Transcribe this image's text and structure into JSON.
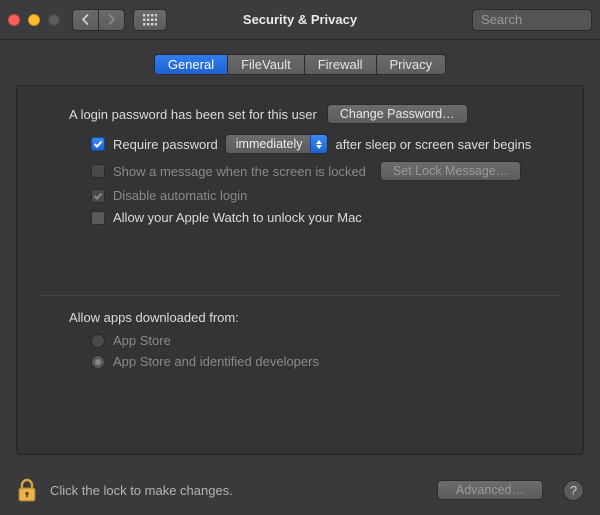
{
  "window": {
    "title": "Security & Privacy"
  },
  "search": {
    "placeholder": "Search",
    "value": ""
  },
  "tabs": {
    "general": "General",
    "filevault": "FileVault",
    "firewall": "Firewall",
    "privacy": "Privacy"
  },
  "general": {
    "login_text": "A login password has been set for this user",
    "change_password_btn": "Change Password…",
    "require_password_label": "Require password",
    "require_password_delay": "immediately",
    "require_password_tail": "after sleep or screen saver begins",
    "show_message_label": "Show a message when the screen is locked",
    "set_lock_message_btn": "Set Lock Message…",
    "disable_auto_login_label": "Disable automatic login",
    "apple_watch_label": "Allow your Apple Watch to unlock your Mac",
    "allow_apps_heading": "Allow apps downloaded from:",
    "gatekeeper_app_store": "App Store",
    "gatekeeper_identified": "App Store and identified developers"
  },
  "footer": {
    "lock_text": "Click the lock to make changes.",
    "advanced_btn": "Advanced…",
    "help_label": "?"
  }
}
